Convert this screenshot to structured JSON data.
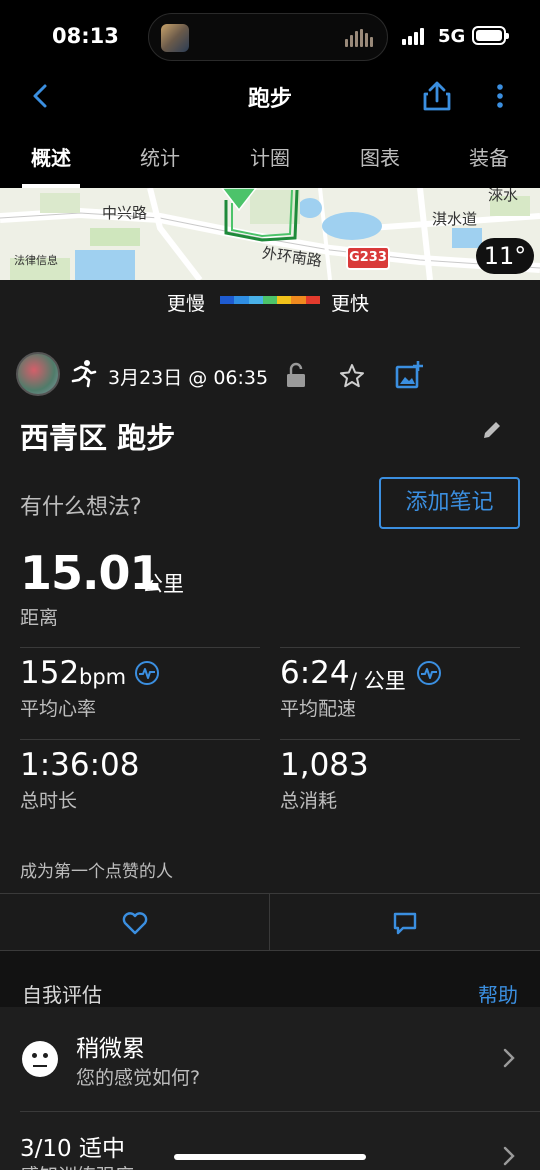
{
  "status_bar": {
    "time": "08:13",
    "network": "5G"
  },
  "nav": {
    "title": "跑步",
    "back_icon": "chevron-left-icon",
    "share_icon": "share-icon",
    "more_icon": "more-vertical-icon",
    "accent": "#3b8fe0"
  },
  "tabs": [
    {
      "label": "概述",
      "active": true
    },
    {
      "label": "统计",
      "active": false
    },
    {
      "label": "计圈",
      "active": false
    },
    {
      "label": "图表",
      "active": false
    },
    {
      "label": "装备",
      "active": false
    }
  ],
  "map": {
    "labels": [
      "中兴路",
      "外环南路",
      "淇水道",
      "淶水"
    ],
    "legal": "法律信息",
    "route_badge": "G233",
    "temperature": "11°"
  },
  "pace_legend": {
    "slower": "更慢",
    "faster": "更快",
    "colors": [
      "#1e5bd1",
      "#2f8ee3",
      "#49b0e8",
      "#4cc36a",
      "#f2c21b",
      "#f08a1f",
      "#e33b2d"
    ]
  },
  "activity": {
    "datetime": "3月23日 @ 06:35",
    "title": "西青区 跑步",
    "thoughts_prompt": "有什么想法?",
    "add_note_label": "添加笔记"
  },
  "stats": {
    "distance": {
      "value": "15.01",
      "unit": "公里",
      "label": "距离"
    },
    "heart_rate": {
      "value": "152",
      "unit": "bpm",
      "label": "平均心率"
    },
    "pace": {
      "value": "6:24",
      "unit": "/ 公里",
      "label": "平均配速"
    },
    "duration": {
      "value": "1:36:08",
      "label": "总时长"
    },
    "calories": {
      "value": "1,083",
      "label": "总消耗"
    }
  },
  "social": {
    "likes_text": "成为第一个点赞的人"
  },
  "self_eval": {
    "title": "自我评估",
    "help_label": "帮助",
    "feeling": {
      "title": "稍微累",
      "subtitle": "您的感觉如何?"
    },
    "effort": {
      "title": "3/10 适中",
      "subtitle": "感知训练强度"
    }
  }
}
